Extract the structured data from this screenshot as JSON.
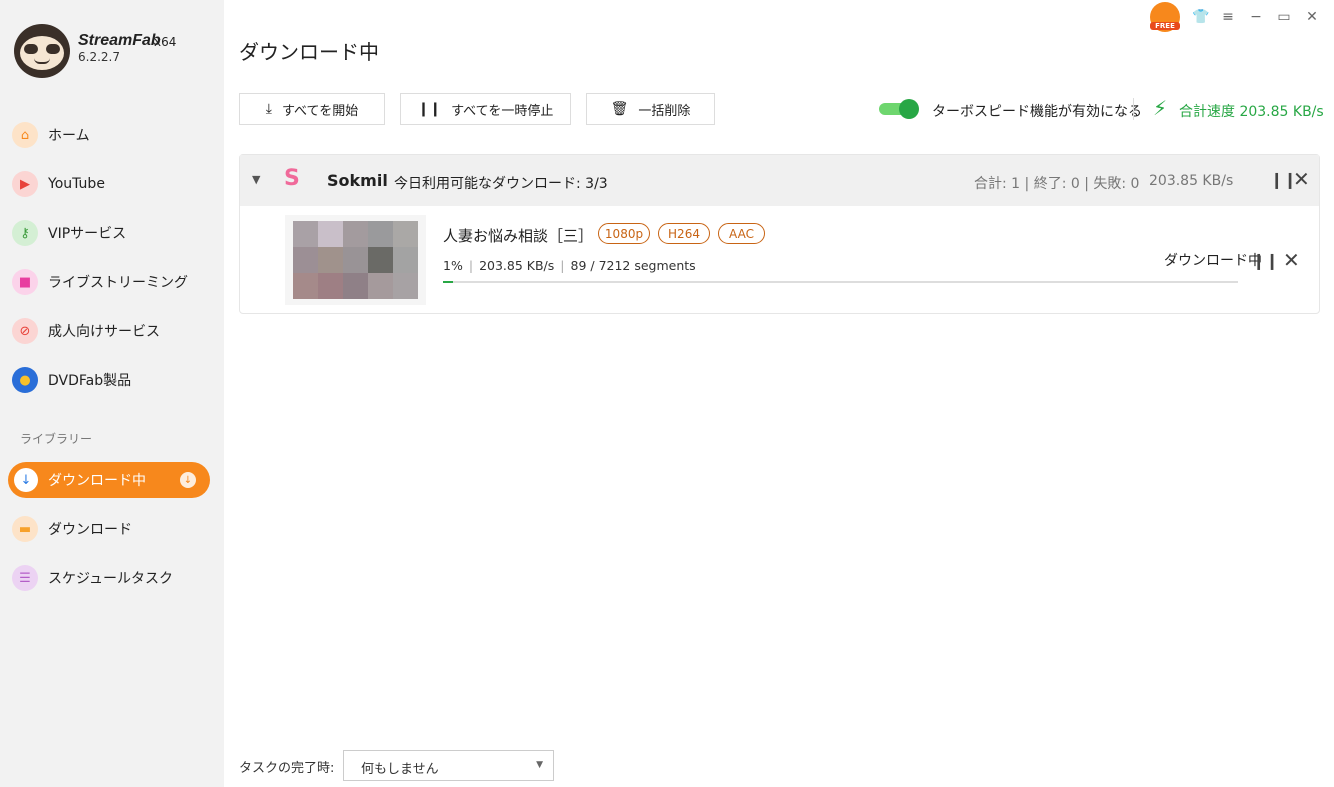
{
  "app": {
    "name": "StreamFab",
    "arch": "x64",
    "version": "6.2.2.7",
    "free_badge": "FREE"
  },
  "sidebar": {
    "items": [
      {
        "label": "ホーム",
        "icon": "home-icon",
        "color": "#f7881c"
      },
      {
        "label": "YouTube",
        "icon": "youtube-icon",
        "color": "#e8423a"
      },
      {
        "label": "VIPサービス",
        "icon": "key-icon",
        "color": "#5cb85c"
      },
      {
        "label": "ライブストリーミング",
        "icon": "camera-icon",
        "color": "#e83ea0"
      },
      {
        "label": "成人向けサービス",
        "icon": "adult-icon",
        "color": "#e8423a"
      },
      {
        "label": "DVDFab製品",
        "icon": "dvdfab-icon",
        "color": "#2a6ed8"
      }
    ],
    "library_title": "ライブラリー",
    "library": [
      {
        "label": "ダウンロード中",
        "icon": "download-icon",
        "active": true
      },
      {
        "label": "ダウンロード",
        "icon": "folder-icon",
        "color": "#f7a12b"
      },
      {
        "label": "スケジュールタスク",
        "icon": "schedule-icon",
        "color": "#b45fc8"
      }
    ]
  },
  "header": {
    "title": "ダウンロード中"
  },
  "toolbar": {
    "start_all": "すべてを開始",
    "pause_all": "すべてを一時停止",
    "delete_all": "一括削除",
    "turbo_label": "ターボスピード機能が有効になる",
    "turbo_on": true,
    "total_speed": "合計速度 203.85 KB/s"
  },
  "group": {
    "site_logo": "S",
    "site_name": "Sokmil",
    "quota": "今日利用可能なダウンロード: 3/3",
    "stats": "合計: 1 | 終了: 0 | 失敗: 0",
    "speed": "203.85 KB/s"
  },
  "task": {
    "title": "人妻お悩み相談［三］",
    "tags": [
      "1080p",
      "H264",
      "AAC"
    ],
    "percent": "1%",
    "progress": 0.0123,
    "speed": "203.85 KB/s",
    "segments": "89 / 7212 segments",
    "status": "ダウンロード中"
  },
  "footer": {
    "completion_label": "タスクの完了時:",
    "completion_value": "何もしません"
  },
  "colors": {
    "accent": "#f7881c",
    "green": "#28a745",
    "tag": "#c86414"
  }
}
